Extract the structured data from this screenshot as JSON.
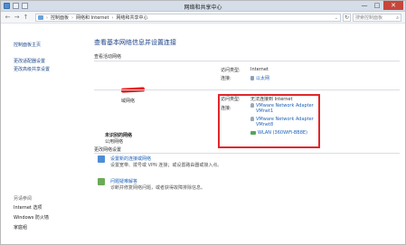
{
  "window": {
    "title": "网络和共享中心",
    "controls": [
      "—",
      "□",
      "✕"
    ]
  },
  "address": {
    "crumbs": [
      "控制面板",
      "网络和 Internet",
      "网络和共享中心"
    ],
    "search_placeholder": "搜索控制面板"
  },
  "sidebar": {
    "items": [
      "控制面板主页",
      "更改适配器设置",
      "更改高级共享设置"
    ],
    "see_also_heading": "另请参阅",
    "see_also": [
      "Internet 选项",
      "Windows 防火墙",
      "家庭组"
    ]
  },
  "main": {
    "title": "查看基本网络信息并设置连接",
    "active_heading": "查看活动网络",
    "network1": {
      "type": "域网络",
      "access_label": "访问类型:",
      "access_value": "Internet",
      "conn_label": "连接:",
      "conn_value": "以太网"
    },
    "network2": {
      "name": "未识别的网络",
      "type": "公用网络",
      "access_label": "访问类型:",
      "access_value": "无法连接到 Internet",
      "conn_label": "连接:",
      "adapters": [
        "VMware Network Adapter",
        "VMnet1",
        "VMware Network Adapter",
        "VMnet8",
        "WLAN (360WiFi-BB8E)"
      ]
    },
    "change_heading": "更改网络设置",
    "tasks": [
      {
        "link": "设置新的连接或网络",
        "desc": "设置宽带、拨号或 VPN 连接；或设置路由器或接入点。"
      },
      {
        "link": "问题疑难解答",
        "desc": "诊断并修复网络问题，或者获得故障排除信息。"
      }
    ]
  }
}
